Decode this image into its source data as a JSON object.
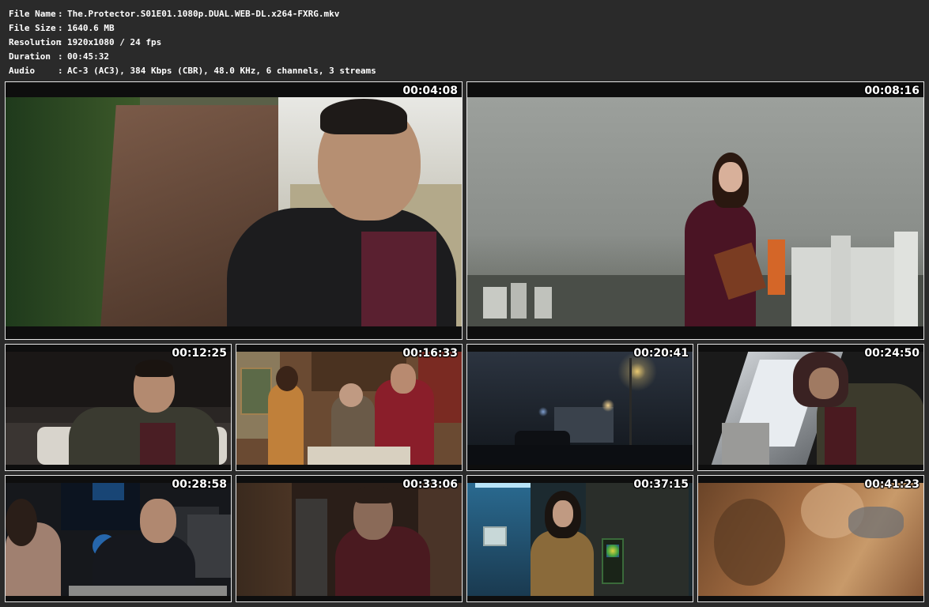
{
  "info": {
    "rows": [
      {
        "label": "File Name",
        "sep": ":",
        "value": "The.Protector.S01E01.1080p.DUAL.WEB-DL.x264-FXRG.mkv"
      },
      {
        "label": "File Size",
        "sep": ":",
        "value": "1640.6 MB"
      },
      {
        "label": "Resolution",
        "sep": ":",
        "value": "1920x1080 / 24 fps"
      },
      {
        "label": "Duration",
        "sep": ":",
        "value": "00:45:32"
      },
      {
        "label": "Audio",
        "sep": ":",
        "value": "AC-3 (AC3), 384 Kbps (CBR), 48.0 KHz, 6 channels, 3 streams"
      }
    ]
  },
  "thumbnails": [
    {
      "timestamp": "00:04:08"
    },
    {
      "timestamp": "00:08:16"
    },
    {
      "timestamp": "00:12:25"
    },
    {
      "timestamp": "00:16:33"
    },
    {
      "timestamp": "00:20:41"
    },
    {
      "timestamp": "00:24:50"
    },
    {
      "timestamp": "00:28:58"
    },
    {
      "timestamp": "00:33:06"
    },
    {
      "timestamp": "00:37:15"
    },
    {
      "timestamp": "00:41:23"
    }
  ]
}
